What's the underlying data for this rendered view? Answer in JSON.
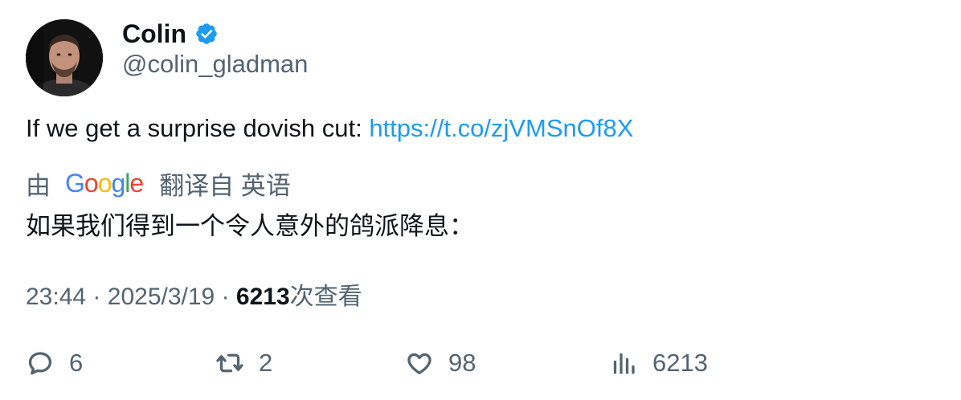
{
  "author": {
    "name": "Colin",
    "handle": "@colin_gladman",
    "verified": true
  },
  "tweet": {
    "text": "If we get a surprise dovish cut: ",
    "link": "https://t.co/zjVMSnOf8X"
  },
  "translation": {
    "prefix": "由",
    "provider": "Google",
    "suffix": "翻译自 英语",
    "text": "如果我们得到一个令人意外的鸽派降息："
  },
  "meta": {
    "time": "23:44",
    "separator": "·",
    "date": "2025/3/19",
    "views_count": "6213",
    "views_label": "次查看"
  },
  "actions": {
    "replies": "6",
    "retweets": "2",
    "likes": "98",
    "views": "6213"
  },
  "colors": {
    "link": "#1d9bf0",
    "secondary_text": "#536471",
    "primary_text": "#0f1419",
    "verified_badge": "#1d9bf0"
  },
  "icons": [
    "verified-badge-icon",
    "reply-icon",
    "retweet-icon",
    "like-icon",
    "views-icon"
  ]
}
